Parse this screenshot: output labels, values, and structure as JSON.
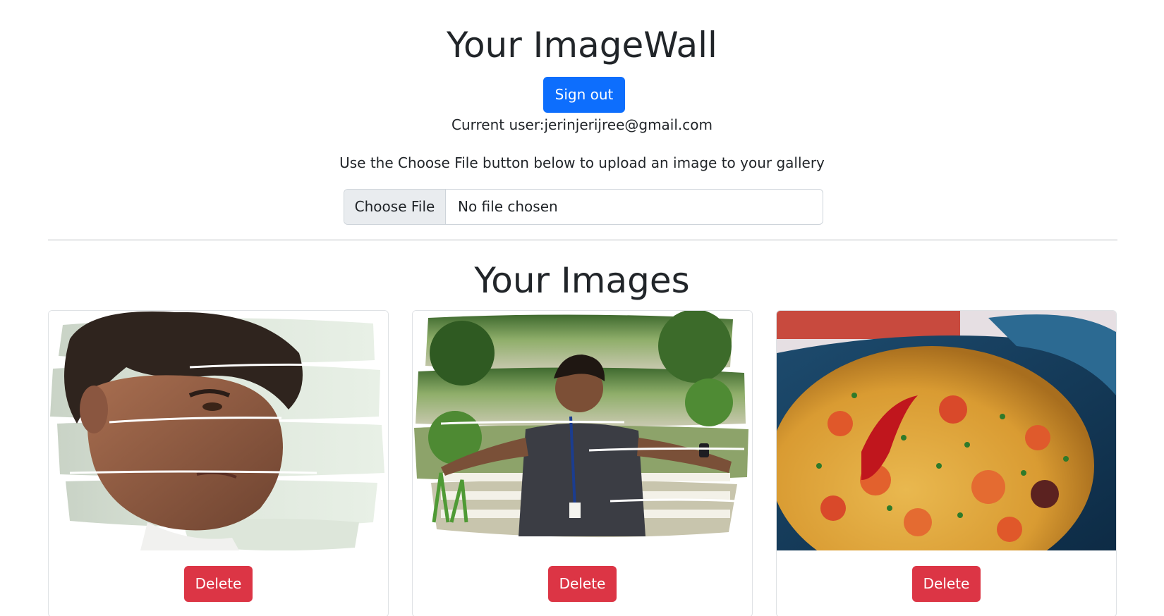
{
  "header": {
    "title": "Your ImageWall",
    "signout_label": "Sign out",
    "current_user": "Current user:jerinjerijree@gmail.com"
  },
  "upload": {
    "instructions": "Use the Choose File button below to upload an image to your gallery",
    "choose_label": "Choose File",
    "status": "No file chosen"
  },
  "gallery": {
    "title": "Your Images",
    "items": [
      {
        "image": "portrait-closeup-brushstroke-photo",
        "delete_label": "Delete"
      },
      {
        "image": "portrait-park-bench-brushstroke-photo",
        "delete_label": "Delete"
      },
      {
        "image": "paella-rice-dish-photo",
        "delete_label": "Delete"
      }
    ]
  },
  "colors": {
    "primary": "#0d6efd",
    "danger": "#dc3545",
    "text": "#212529",
    "input_border": "#ced4da",
    "file_button_bg": "#e9ecef"
  }
}
